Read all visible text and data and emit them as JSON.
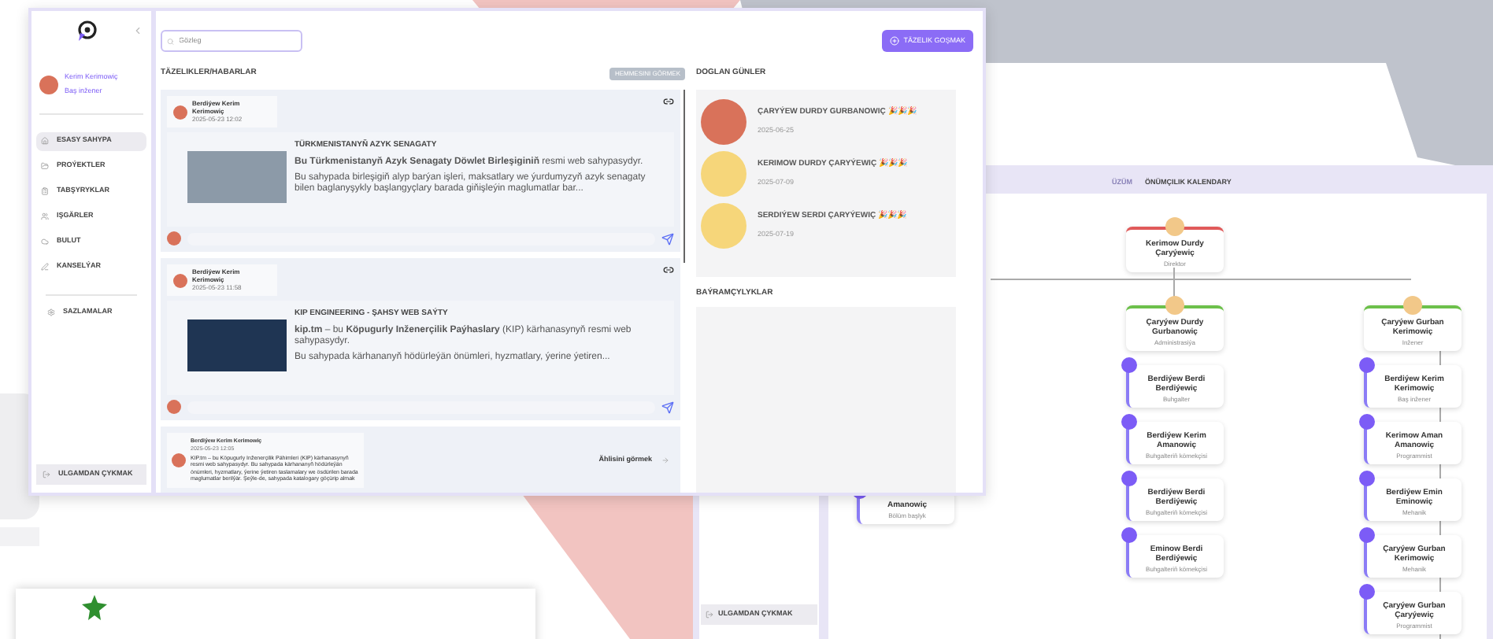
{
  "main_window": {
    "sidebar": {
      "user": {
        "name": "Kerim Kerimowiç",
        "role": "Baş inžener"
      },
      "items": [
        {
          "label": "ESASY SAHYPA",
          "selected": true
        },
        {
          "label": "PROÝEKTLER",
          "selected": false
        },
        {
          "label": "TABŞYRYKLAR",
          "selected": false
        },
        {
          "label": "IŞGÄRLER",
          "selected": false
        },
        {
          "label": "BULUT",
          "selected": false
        },
        {
          "label": "KANSELÝAR",
          "selected": false
        }
      ],
      "settings": "SAZLAMALAR",
      "logout": "ULGAMDAN ÇYKMAK"
    },
    "search": {
      "placeholder": "Gözleg"
    },
    "add_button": "TÄZELIK GOŞMAK",
    "news": {
      "title": "TÄZELIKLER/HABARLAR",
      "see_all": "HEMMESINI GÖRMEK",
      "posts": [
        {
          "author": "Berdiýew Kerim Kerimowiç",
          "date": "2025-05-23 12:02",
          "title": "TÜRKMENISTANYŇ AZYK SENAGATY",
          "lead": "**Bu Türkmenistanyň Azyk Senagaty Döwlet Birleşiginiň** resmi web sahypasydyr.",
          "body": "Bu sahypada birleşigiň alyp barýan işleri, maksatlary we ýurdumyzyň azyk senagaty bilen baglanyşykly başlangyçlary barada giňişleýin maglumatlar bar..."
        },
        {
          "author": "Berdiýew Kerim Kerimowiç",
          "date": "2025-05-23 11:58",
          "title": "KIP ENGINEERING - ŞAHSY WEB SAÝTY",
          "lead": "**kip.tm** – bu **Köpugurly Inženerçilik Paýhaslary** (KIP) kärhanasynyň resmi web sahypasydyr.",
          "body": "Bu sahypada kärhananyň hödürleýän önümleri, hyzmatlary, ýerine ýetiren..."
        }
      ],
      "comment": {
        "author": "Berdiýew Kerim Kerimowiç",
        "date": "2025-05-23 12:05",
        "text": "KIP.tm – bu Köpugurly Inženerçilik Pähimleri (KIP) kärhanasynyň resmi web sahypasydyr. Bu sahypada kärhananyň hödürleýän önümleri, hyzmatlary, ýerine ýetiren taslamalary we ösdürilen barada maglumatlar berilýär. Şeýle-de, sahypada katalogary göçürip almak",
        "link": "Ählisini görmek"
      }
    },
    "birthdays": {
      "title": "DOGLAN GÜNLER",
      "people": [
        {
          "name": "ÇARYÝEW DURDY GURBANOWIÇ 🎉🎉🎉",
          "date": "2025-06-25",
          "color": "#d9725a"
        },
        {
          "name": "KERIMOW DURDY ÇARYÝEWIÇ 🎉🎉🎉",
          "date": "2025-07-09",
          "color": "#f6d67a"
        },
        {
          "name": "SERDIÝEW SERDI ÇARYÝEWIÇ 🎉🎉🎉",
          "date": "2025-07-19",
          "color": "#f6d67a"
        }
      ]
    },
    "holidays": {
      "title": "BAÝRAMÇYLYKLAR"
    }
  },
  "org_window": {
    "tabs": [
      {
        "label": "ÜZÜM",
        "selected": false
      },
      {
        "label": "ÖNÜMÇILIK KALENDARY",
        "selected": true
      }
    ],
    "logout": "ULGAMDAN ÇYKMAK",
    "partial_node": {
      "name": "Amanowiç",
      "role": "Bölüm başlyk"
    },
    "top": {
      "name": "Kerimow Durdy Çaryýewiç",
      "role": "Direktor",
      "color": "#e05a5a"
    },
    "columns": [
      {
        "head": {
          "name": "Çaryýew Durdy Gurbanowiç",
          "role": "Administrasiýa",
          "color": "#6cc04a"
        },
        "members": [
          {
            "name": "Berdiýew Berdi Berdiýewiç",
            "role": "Buhgalter"
          },
          {
            "name": "Berdiýew Kerim Amanowiç",
            "role": "Buhgalteriň kömekçisi"
          },
          {
            "name": "Berdiýew Berdi Berdiýewiç",
            "role": "Buhgalteriň kömekçisi"
          },
          {
            "name": "Eminow Berdi Berdiýewiç",
            "role": "Buhgalteriň kömekçisi"
          }
        ]
      },
      {
        "head": {
          "name": "Çaryýew Gurban Kerimowiç",
          "role": "Inžener",
          "color": "#6cc04a"
        },
        "members": [
          {
            "name": "Berdiýew Kerim Kerimowiç",
            "role": "Baş inžener"
          },
          {
            "name": "Kerimow Aman Amanowiç",
            "role": "Programmist"
          },
          {
            "name": "Berdiýew Emin Eminowiç",
            "role": "Mehanik"
          },
          {
            "name": "Çaryýew Gurban Kerimowiç",
            "role": "Mehanik"
          },
          {
            "name": "Çaryýew Gurban Çaryýewiç",
            "role": "Programmist"
          }
        ]
      }
    ]
  }
}
